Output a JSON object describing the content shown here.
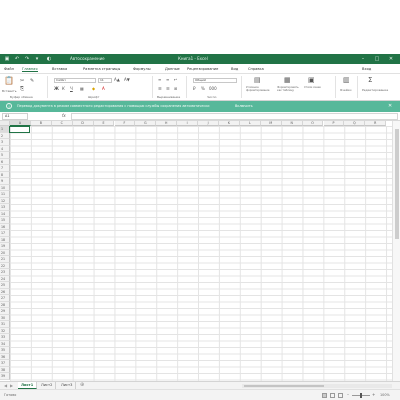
{
  "window": {
    "filename": "Автосохранение",
    "title": "Книга1 - Excel"
  },
  "menu": {
    "items": [
      "Файл",
      "Главная",
      "Вставка",
      "Разметка страницы",
      "Формулы",
      "Данные",
      "Рецензирование",
      "Вид",
      "Справка"
    ],
    "user": "Вход"
  },
  "ribbon": {
    "font_name": "Calibri",
    "font_size": "11",
    "number_format": "Общий",
    "paste_label": "Вставить",
    "cond_format_label": "Условное форматирование",
    "table_label": "Форматировать как таблицу",
    "styles_label": "Стили ячеек",
    "cells_label": "Ячейки",
    "edit_label": "Редактирование",
    "clipboard_caption": "Буфер обмена",
    "font_caption": "Шрифт",
    "align_caption": "Выравнивание",
    "number_caption": "Число"
  },
  "notification": {
    "text": "Перевод документа в режим совместного редактирования с помощью службы сохранения автоматически",
    "button": "Включить"
  },
  "formula_bar": {
    "name_box": "A1",
    "fx": "fx",
    "value": ""
  },
  "grid": {
    "columns": [
      "A",
      "B",
      "C",
      "D",
      "E",
      "F",
      "G",
      "H",
      "I",
      "J",
      "K",
      "L",
      "M",
      "N",
      "O",
      "P",
      "Q",
      "R"
    ],
    "rows": [
      "1",
      "2",
      "3",
      "4",
      "5",
      "6",
      "7",
      "8",
      "9",
      "10",
      "11",
      "12",
      "13",
      "14",
      "15",
      "16",
      "17",
      "18",
      "19",
      "20",
      "21",
      "22",
      "23",
      "24",
      "25",
      "26",
      "27",
      "28",
      "29",
      "30",
      "31",
      "32",
      "33",
      "34",
      "35",
      "36",
      "37",
      "38",
      "39"
    ],
    "active_cell": "A1"
  },
  "sheets": {
    "tabs": [
      "Лист1",
      "Лист2",
      "Лист3"
    ],
    "active": "Лист1"
  },
  "status": {
    "ready": "Готово",
    "zoom": "100%"
  },
  "colors": {
    "accent": "#217346",
    "notification_bg": "#57b89a"
  },
  "icons": {
    "titlebar": [
      "save-icon",
      "undo-icon",
      "redo-icon",
      "customize-icon"
    ],
    "window_controls": [
      "minimize-icon",
      "maximize-icon",
      "close-icon"
    ]
  }
}
